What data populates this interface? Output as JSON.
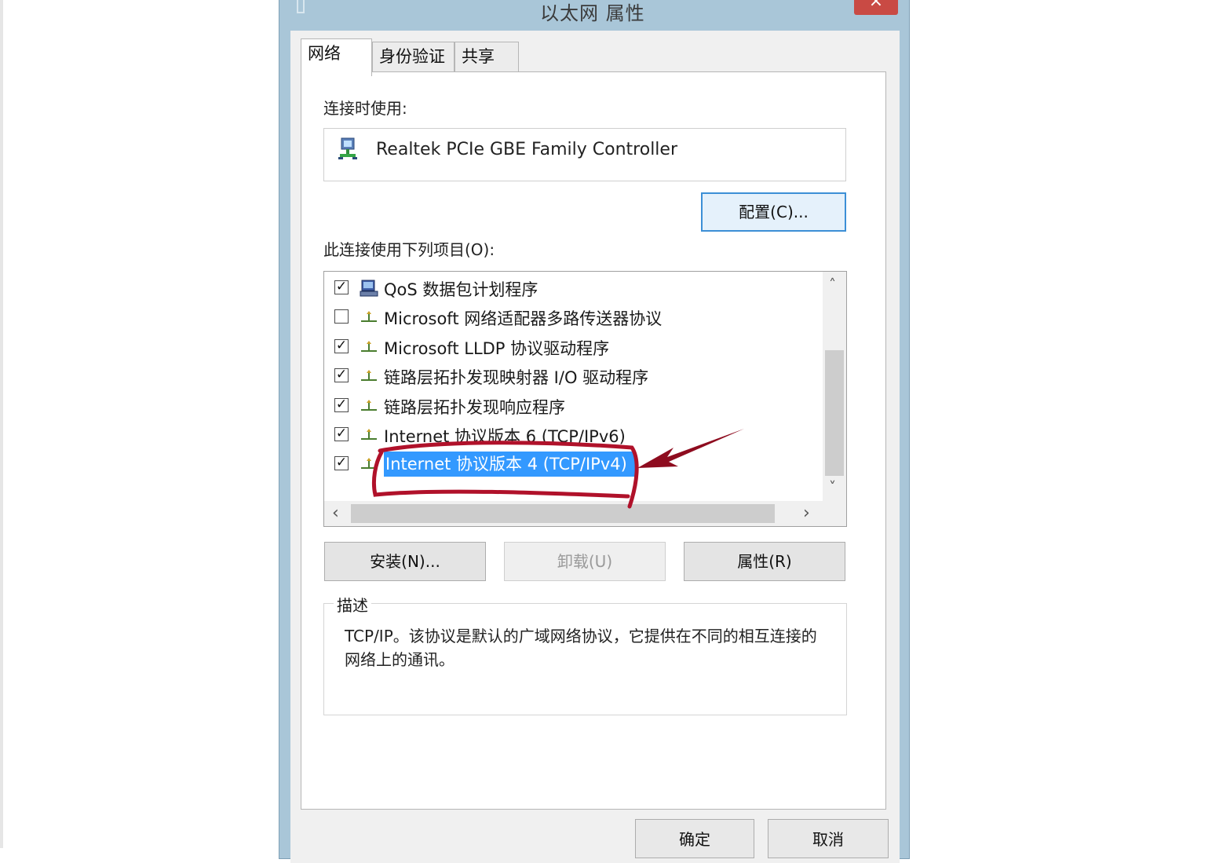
{
  "window": {
    "title": "以太网 属性",
    "close_glyph": "×"
  },
  "tabs": [
    {
      "label": "网络",
      "active": true
    },
    {
      "label": "身份验证",
      "active": false
    },
    {
      "label": "共享",
      "active": false
    }
  ],
  "connect_using_label": "连接时使用:",
  "adapter": {
    "name": "Realtek PCIe GBE Family Controller",
    "icon": "network-adapter-icon"
  },
  "configure_button": "配置(C)...",
  "items_label": "此连接使用下列项目(O):",
  "items": [
    {
      "label": "QoS 数据包计划程序",
      "checked": true,
      "icon": "qos-scheduler-icon",
      "selected": false
    },
    {
      "label": "Microsoft 网络适配器多路传送器协议",
      "checked": false,
      "icon": "protocol-icon",
      "selected": false
    },
    {
      "label": "Microsoft LLDP 协议驱动程序",
      "checked": true,
      "icon": "protocol-icon",
      "selected": false
    },
    {
      "label": "链路层拓扑发现映射器 I/O 驱动程序",
      "checked": true,
      "icon": "protocol-icon",
      "selected": false
    },
    {
      "label": "链路层拓扑发现响应程序",
      "checked": true,
      "icon": "protocol-icon",
      "selected": false
    },
    {
      "label": "Internet 协议版本 6 (TCP/IPv6)",
      "checked": true,
      "icon": "protocol-icon",
      "selected": false
    },
    {
      "label": "Internet 协议版本 4 (TCP/IPv4)",
      "checked": true,
      "icon": "protocol-icon",
      "selected": true
    }
  ],
  "checkmark_glyph": "✓",
  "scroll_arrows": {
    "up": "˄",
    "down": "˅",
    "left": "‹",
    "right": "›"
  },
  "buttons": {
    "install": "安装(N)...",
    "uninstall": "卸载(U)",
    "properties": "属性(R)"
  },
  "description": {
    "title": "描述",
    "text": "TCP/IP。该协议是默认的广域网络协议，它提供在不同的相互连接的网络上的通讯。"
  },
  "footer_buttons": {
    "ok": "确定",
    "cancel": "取消"
  },
  "colors": {
    "selection": "#3399ff",
    "annotation": "#b0112a",
    "frame": "#a9c6d8"
  }
}
